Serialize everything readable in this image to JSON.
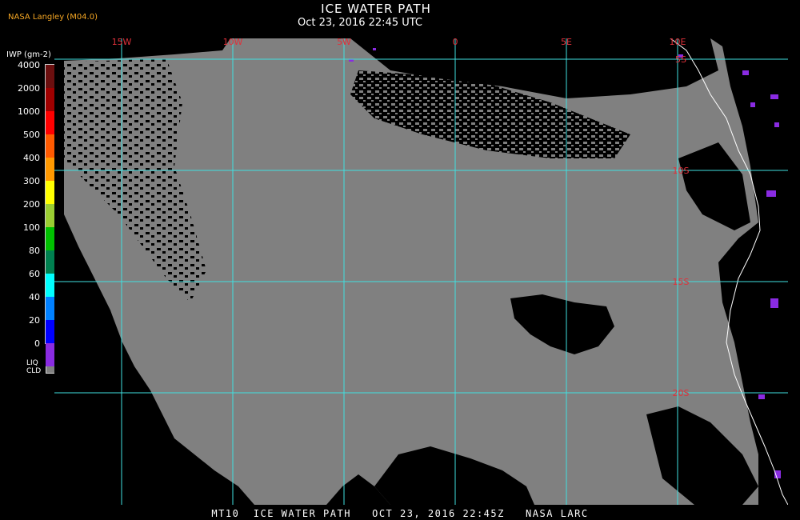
{
  "title": "ICE WATER PATH",
  "subtitle": "Oct 23, 2016 22:45 UTC",
  "credit": "NASA Langley (M04.0)",
  "legend": {
    "unit": "IWP (gm-2)",
    "levels": [
      {
        "label": "4000",
        "color": "#6b0f0f"
      },
      {
        "label": "2000",
        "color": "#a00000"
      },
      {
        "label": "1000",
        "color": "#ff0000"
      },
      {
        "label": "500",
        "color": "#ff5a00"
      },
      {
        "label": "400",
        "color": "#ff9900"
      },
      {
        "label": "300",
        "color": "#ffff00"
      },
      {
        "label": "200",
        "color": "#9acd32"
      },
      {
        "label": "100",
        "color": "#00c000"
      },
      {
        "label": "80",
        "color": "#008050"
      },
      {
        "label": "60",
        "color": "#00ffff"
      },
      {
        "label": "40",
        "color": "#0080ff"
      },
      {
        "label": "20",
        "color": "#0000ff"
      },
      {
        "label": "0",
        "color": "#8a2be2"
      }
    ],
    "liq_label_1": "LIQ",
    "liq_label_2": "CLD",
    "liq_color": "#808080"
  },
  "map": {
    "longitudes": [
      "15W",
      "10W",
      "5W",
      "0",
      "5E",
      "10E"
    ],
    "latitudes": [
      "5S",
      "10S",
      "15S",
      "20S"
    ],
    "grid_color": "#40e0e0",
    "label_color": "#e0303a",
    "cloud_color": "#808080",
    "background_color": "#000000",
    "coastline_color": "#ffffff",
    "ice_color": "#8a2be2"
  },
  "footer": "MT10  ICE WATER PATH   OCT 23, 2016 22:45Z   NASA LARC"
}
